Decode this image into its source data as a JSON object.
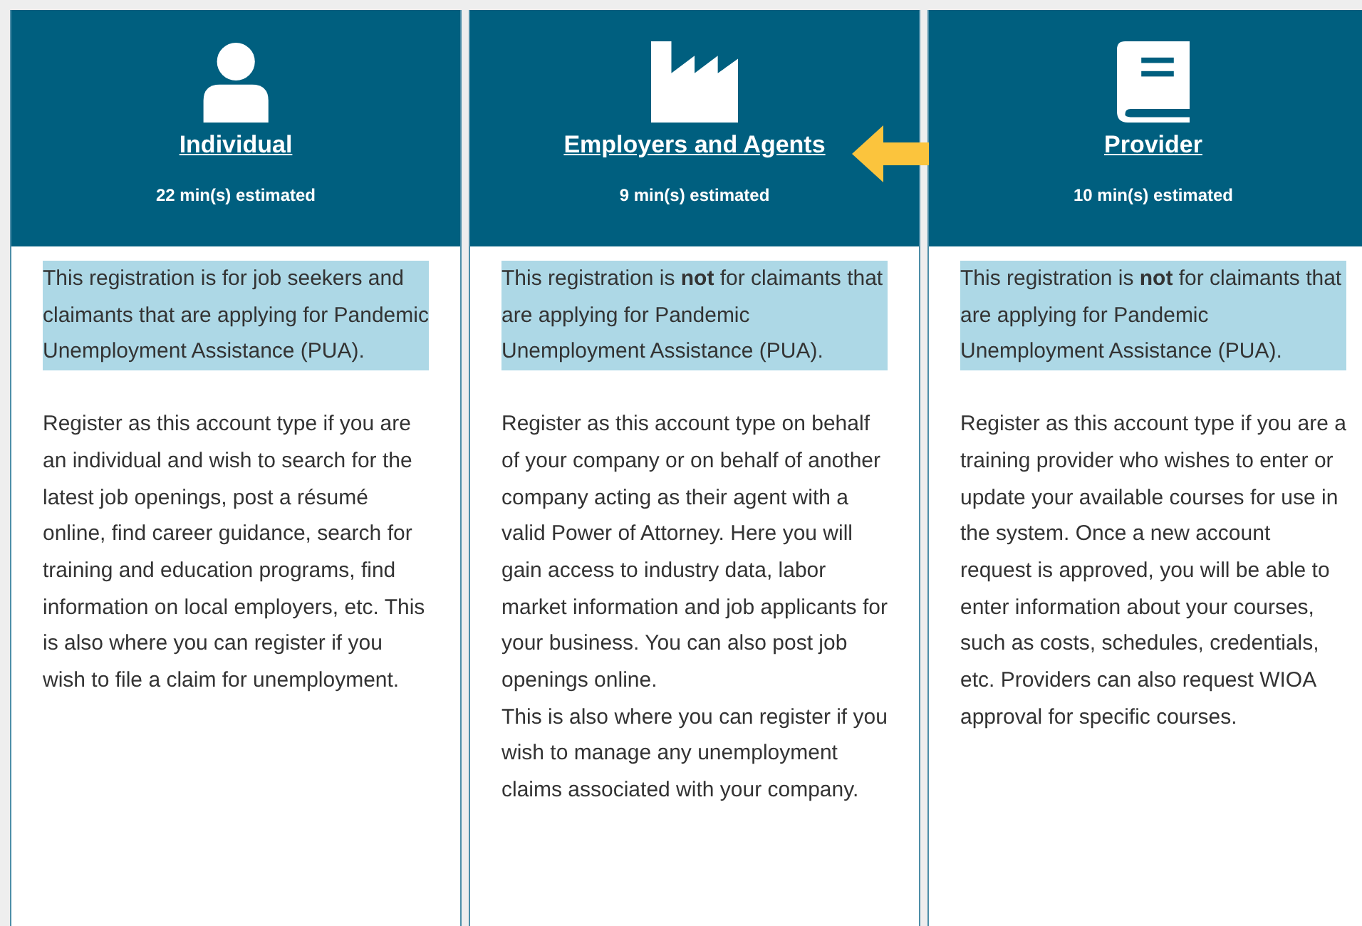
{
  "account_types": [
    {
      "title": "Individual",
      "estimate": "22 min(s) estimated",
      "note": "This registration is for job seekers and claimants that are applying for Pandemic Unemployment Assistance (PUA).",
      "paragraphs": [
        "Register as this account type if you are an individual and wish to search for the latest job openings, post a résumé online, find career guidance, search for training and education programs, find information on local employers, etc. This is also where you can register if you wish to file a claim for unemployment."
      ],
      "pointed": false
    },
    {
      "title": "Employers and Agents",
      "estimate": "9 min(s) estimated",
      "note": "This registration is **not** for claimants that are applying for Pandemic Unemployment Assistance (PUA).",
      "paragraphs": [
        "Register as this account type on behalf of your company or on behalf of another company acting as their agent with a valid Power of Attorney. Here you will gain access to industry data, labor market information and job applicants for your business. You can also post job openings online.",
        "This is also where you can register if you wish to manage any unemployment claims associated with your company."
      ],
      "pointed": true
    },
    {
      "title": "Provider",
      "estimate": "10 min(s) estimated",
      "note": "This registration is **not** for claimants that are applying for Pandemic Unemployment Assistance (PUA).",
      "paragraphs": [
        "Register as this account type if you are a training provider who wishes to enter or update your available courses for use in the system. Once a new account request is approved, you will be able to enter information about your courses, such as costs, schedules, credentials, etc. Providers can also request WIOA approval for specific courses."
      ],
      "pointed": false
    }
  ]
}
